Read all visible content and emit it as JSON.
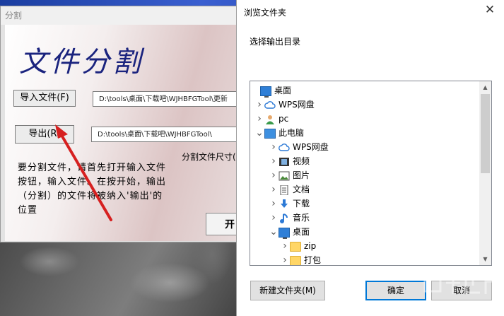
{
  "app": {
    "title": "分割",
    "heading": "文件分割",
    "import_button": "导入文件(F)",
    "import_path": "D:\\tools\\桌面\\下载吧\\WJHBFGTool\\更新",
    "export_button": "导出(R)",
    "export_path": "D:\\tools\\桌面\\下载吧\\WJHBFGTool\\",
    "size_label": "分割文件尺寸(",
    "description": "要分割文件，请首先打开输入文件按钮，输入文件。在按开始，输出（分割）的文件将被纳入'输出'的位置",
    "start_button": "开"
  },
  "dialog": {
    "title": "浏览文件夹",
    "close_glyph": "✕",
    "prompt": "选择输出目录",
    "tree": [
      {
        "label": "桌面",
        "icon": "desktop-icon",
        "expander": "",
        "level": 0
      },
      {
        "label": "WPS网盘",
        "icon": "cloud-icon",
        "expander": ">",
        "level": 1
      },
      {
        "label": "pc",
        "icon": "user-icon",
        "expander": ">",
        "level": 1
      },
      {
        "label": "此电脑",
        "icon": "monitor-icon",
        "expander": "v",
        "level": 1
      },
      {
        "label": "WPS网盘",
        "icon": "cloud-icon",
        "expander": ">",
        "level": 2
      },
      {
        "label": "视频",
        "icon": "video-icon",
        "expander": ">",
        "level": 2
      },
      {
        "label": "图片",
        "icon": "picture-icon",
        "expander": ">",
        "level": 2
      },
      {
        "label": "文档",
        "icon": "document-icon",
        "expander": ">",
        "level": 2
      },
      {
        "label": "下载",
        "icon": "download-icon",
        "expander": ">",
        "level": 2
      },
      {
        "label": "音乐",
        "icon": "music-icon",
        "expander": ">",
        "level": 2
      },
      {
        "label": "桌面",
        "icon": "desktop-icon",
        "expander": "v",
        "level": 2
      },
      {
        "label": "zip",
        "icon": "folder-icon",
        "expander": ">",
        "level": 3
      },
      {
        "label": "打包",
        "icon": "folder-icon",
        "expander": ">",
        "level": 3
      }
    ],
    "new_folder_button": "新建文件夹(M)",
    "ok_button": "确定",
    "cancel_button": "取消"
  },
  "colors": {
    "heading": "#1a237e",
    "accent": "#0078d7",
    "arrow": "#d62020"
  }
}
